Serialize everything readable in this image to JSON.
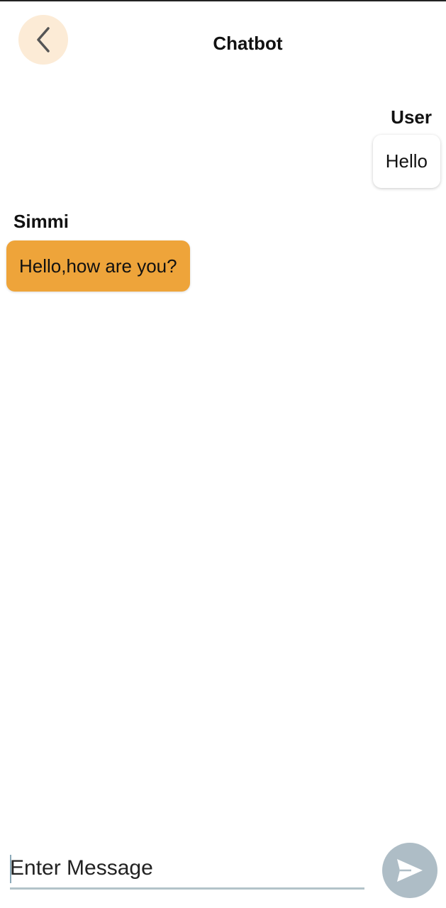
{
  "header": {
    "title": "Chatbot",
    "back_icon": "chevron-left-icon"
  },
  "messages": [
    {
      "sender": "User",
      "text": "Hello",
      "side": "right"
    },
    {
      "sender": "Simmi",
      "text": "Hello,how are you?",
      "side": "left"
    }
  ],
  "composer": {
    "placeholder": "Enter Message",
    "value": "",
    "send_icon": "send-icon"
  },
  "colors": {
    "back_button_bg": "#fcebd6",
    "bot_bubble": "#eea43a",
    "user_bubble": "#ffffff",
    "send_button_bg": "#aebdc6",
    "input_underline": "#b3c3c9"
  }
}
